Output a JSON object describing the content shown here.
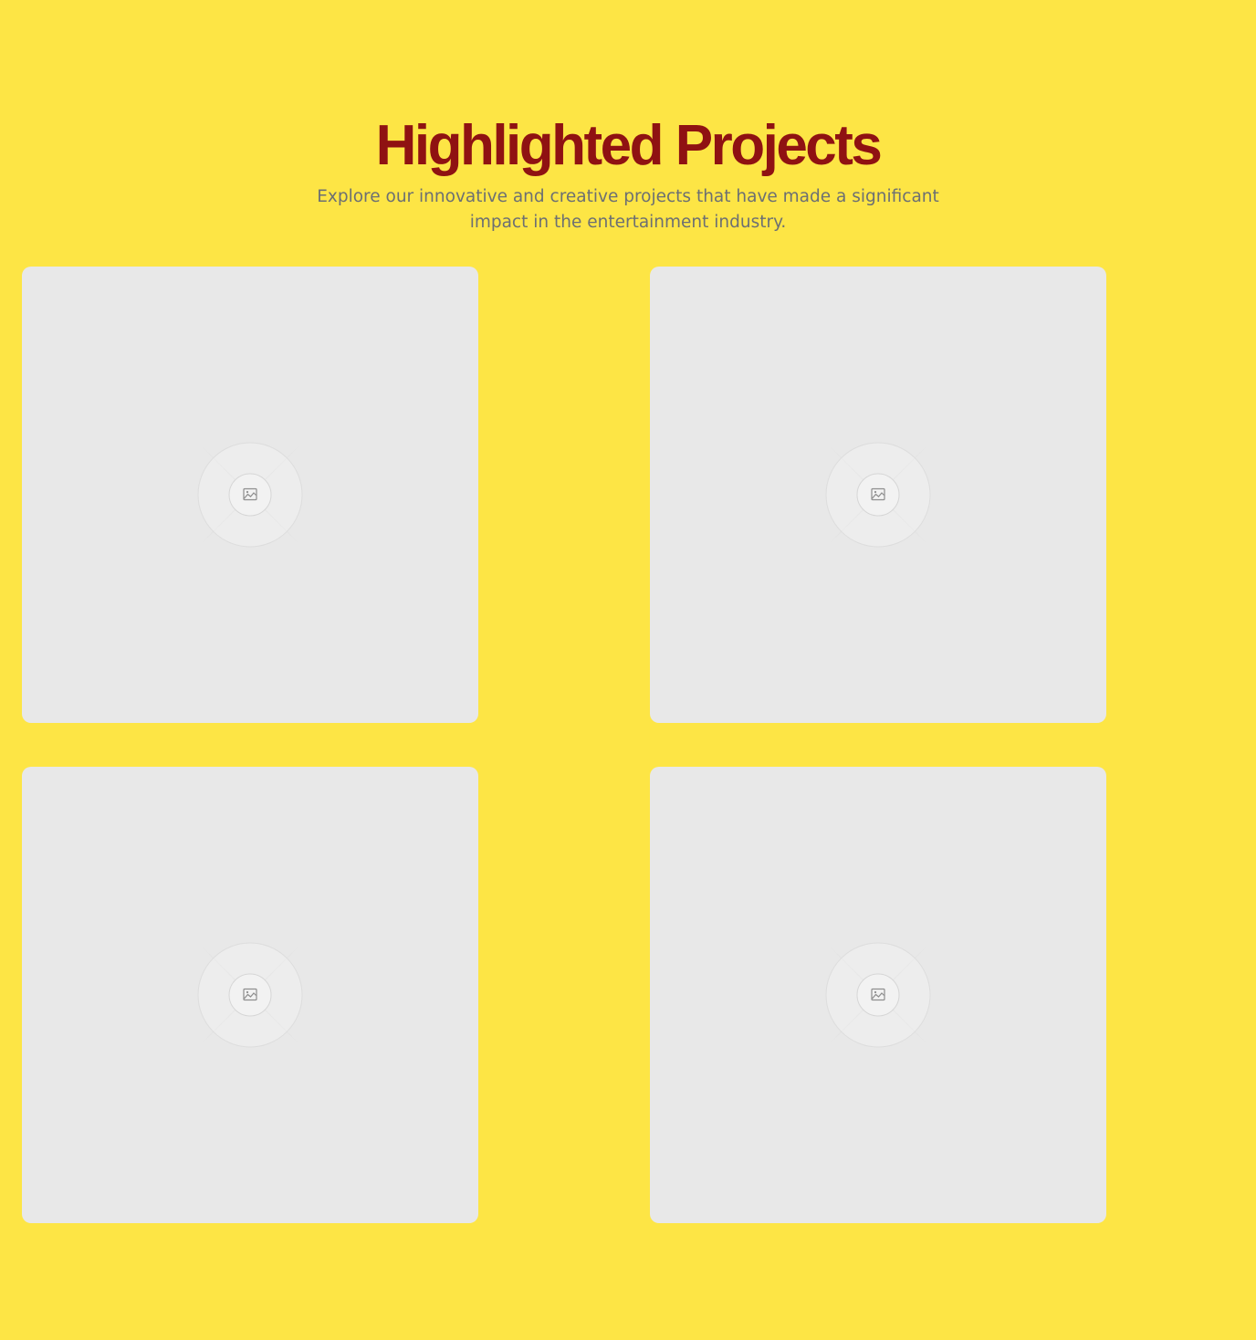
{
  "header": {
    "title": "Highlighted Projects",
    "subtitle": "Explore our innovative and creative projects that have made a significant impact in the entertainment industry."
  },
  "colors": {
    "background": "#fde545",
    "title": "#8f1212",
    "subtitle": "#6c6f73",
    "card": "#e8e8e8"
  },
  "projects": [
    {
      "icon": "image-placeholder-icon"
    },
    {
      "icon": "image-placeholder-icon"
    },
    {
      "icon": "image-placeholder-icon"
    },
    {
      "icon": "image-placeholder-icon"
    }
  ]
}
